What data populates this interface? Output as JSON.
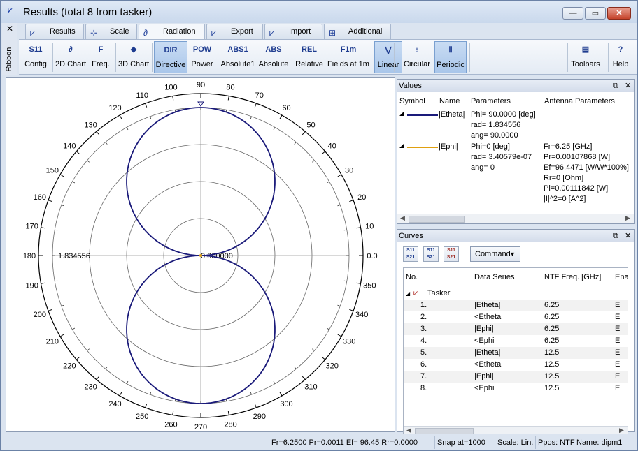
{
  "window": {
    "title": "Results (total 8 from tasker)",
    "app_icon": "chart-app-icon",
    "min_label": "—",
    "max_label": "▭",
    "close_label": "✕"
  },
  "ribbon_side": {
    "close": "✕",
    "label": "Ribbon"
  },
  "tabs": [
    {
      "label": "Results",
      "icon": "results-tab-icon"
    },
    {
      "label": "Scale",
      "icon": "scale-tab-icon"
    },
    {
      "label": "Radiation",
      "icon": "radiation-tab-icon",
      "active": true
    },
    {
      "label": "Export",
      "icon": "export-tab-icon"
    },
    {
      "label": "Import",
      "icon": "import-tab-icon"
    },
    {
      "label": "Additional",
      "icon": "additional-tab-icon"
    }
  ],
  "ribbon": {
    "buttons": [
      {
        "icon_text": "S11",
        "label": "Config"
      },
      {
        "icon_text": "∂",
        "label": "2D Chart"
      },
      {
        "icon_text": "F",
        "label": "Freq."
      },
      {
        "icon_text": "◆",
        "label": "3D Chart"
      },
      {
        "icon_text": "DIR",
        "label": "Directive",
        "active": true
      },
      {
        "icon_text": "POW",
        "label": "Power"
      },
      {
        "icon_text": "ABS1",
        "label": "Absolute1"
      },
      {
        "icon_text": "ABS",
        "label": "Absolute"
      },
      {
        "icon_text": "REL",
        "label": "Relative"
      },
      {
        "icon_text": "F1m",
        "label": "Fields at 1m"
      },
      {
        "icon_text": "⋁",
        "label": "Linear",
        "active": true
      },
      {
        "icon_text": "♁",
        "label": "Circular"
      },
      {
        "icon_text": "⦀",
        "label": "Periodic",
        "active": true
      },
      {
        "icon_text": "▤",
        "label": "Toolbars"
      },
      {
        "icon_text": "?",
        "label": "Help"
      }
    ]
  },
  "polar": {
    "angle_labels": [
      "0.0",
      "10",
      "20",
      "30",
      "40",
      "50",
      "60",
      "70",
      "80",
      "90",
      "100",
      "110",
      "120",
      "130",
      "140",
      "150",
      "160",
      "170",
      "180",
      "190",
      "200",
      "210",
      "220",
      "230",
      "240",
      "250",
      "260",
      "270",
      "280",
      "290",
      "300",
      "310",
      "320",
      "330",
      "340",
      "350"
    ],
    "radius_max_label": "1.834556",
    "radius_center_label": "0.000000",
    "series_color": "#1a1a7a",
    "max_value": 1.834556
  },
  "values_pane": {
    "title": "Values",
    "columns": [
      "Symbol",
      "Name",
      "Parameters",
      "Antenna Parameters"
    ],
    "rows": [
      {
        "name": "|Etheta|",
        "color": "#1a1a7a",
        "params": [
          "Phi= 90.0000 [deg]",
          "rad= 1.834556",
          "ang= 90.0000"
        ],
        "antenna": []
      },
      {
        "name": "|Ephi|",
        "color": "#e0a010",
        "params": [
          "Phi=0 [deg]",
          "rad= 3.40579e-07",
          "ang= 0"
        ],
        "antenna": [
          "Fr=6.25 [GHz]",
          "Pr=0.00107868 [W]",
          "Ef=96.4471 [W/W*100%]",
          "Rr=0 [Ohm]",
          "Pi=0.00111842 [W]",
          "|I|^2=0 [A^2]"
        ]
      }
    ]
  },
  "curves_pane": {
    "title": "Curves",
    "command_label": "Command",
    "columns": [
      "No.",
      "Data Series",
      "NTF Freq. [GHz]",
      "Ena"
    ],
    "group": "Tasker",
    "rows": [
      {
        "no": "1.",
        "series": "|Etheta|",
        "freq": "6.25",
        "ena": "E"
      },
      {
        "no": "2.",
        "series": "<Etheta",
        "freq": "6.25",
        "ena": "E"
      },
      {
        "no": "3.",
        "series": "|Ephi|",
        "freq": "6.25",
        "ena": "E"
      },
      {
        "no": "4.",
        "series": "<Ephi",
        "freq": "6.25",
        "ena": "E"
      },
      {
        "no": "5.",
        "series": "|Etheta|",
        "freq": "12.5",
        "ena": "E"
      },
      {
        "no": "6.",
        "series": "<Etheta",
        "freq": "12.5",
        "ena": "E"
      },
      {
        "no": "7.",
        "series": "|Ephi|",
        "freq": "12.5",
        "ena": "E"
      },
      {
        "no": "8.",
        "series": "<Ephi",
        "freq": "12.5",
        "ena": "E"
      }
    ]
  },
  "status": {
    "main": "Fr=6.2500 Pr=0.0011 Ef= 96.45 Rr=0.0000",
    "snap": "Snap at=1000",
    "scale": "Scale: Lin.",
    "ppos": "Ppos: NTF",
    "name": "Name: dipm1"
  }
}
